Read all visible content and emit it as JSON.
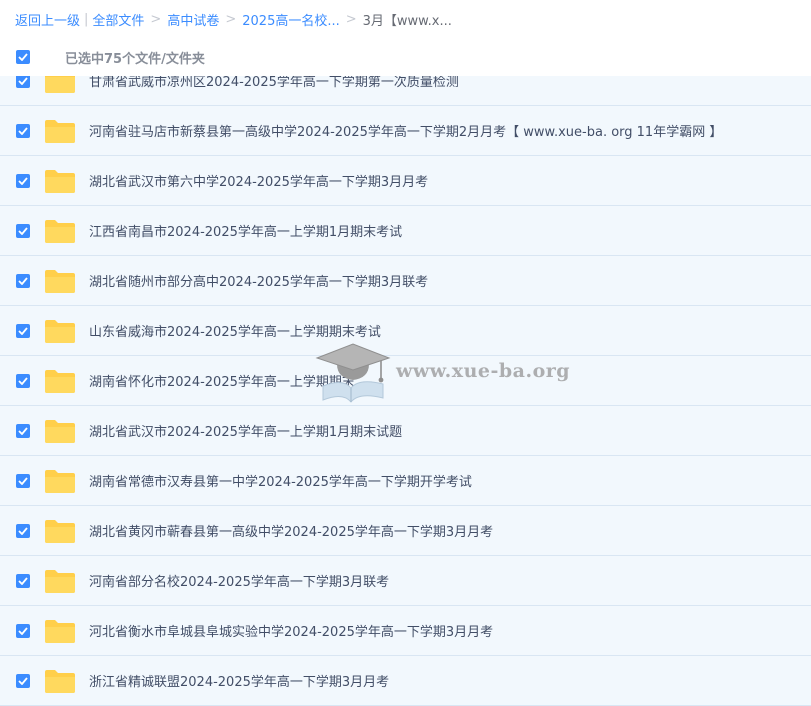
{
  "breadcrumb": {
    "back": "返回上一级",
    "all_files": "全部文件",
    "crumbs": [
      "高中试卷",
      "2025高一名校...",
      "3月【www.x..."
    ]
  },
  "selection": {
    "text": "已选中75个文件/文件夹",
    "checked": true
  },
  "files": [
    {
      "name": "甘肃省武威市凉州区2024-2025学年高一下学期第一次质量检测",
      "checked": true
    },
    {
      "name": "河南省驻马店市新蔡县第一高级中学2024-2025学年高一下学期2月月考【 www.xue-ba. org 11年学霸网 】",
      "checked": true
    },
    {
      "name": "湖北省武汉市第六中学2024-2025学年高一下学期3月月考",
      "checked": true
    },
    {
      "name": "江西省南昌市2024-2025学年高一上学期1月期末考试",
      "checked": true
    },
    {
      "name": "湖北省随州市部分高中2024-2025学年高一下学期3月联考",
      "checked": true
    },
    {
      "name": "山东省威海市2024-2025学年高一上学期期末考试",
      "checked": true
    },
    {
      "name": "湖南省怀化市2024-2025学年高一上学期期末",
      "checked": true
    },
    {
      "name": "湖北省武汉市2024-2025学年高一上学期1月期末试题",
      "checked": true
    },
    {
      "name": "湖南省常德市汉寿县第一中学2024-2025学年高一下学期开学考试",
      "checked": true
    },
    {
      "name": "湖北省黄冈市蕲春县第一高级中学2024-2025学年高一下学期3月月考",
      "checked": true
    },
    {
      "name": "河南省部分名校2024-2025学年高一下学期3月联考",
      "checked": true
    },
    {
      "name": "河北省衡水市阜城县阜城实验中学2024-2025学年高一下学期3月月考",
      "checked": true
    },
    {
      "name": "浙江省精诚联盟2024-2025学年高一下学期3月月考",
      "checked": true
    }
  ],
  "icons": {
    "checkbox": "checkbox-checked-icon",
    "folder": "folder-icon",
    "watermark": "graduation-cap-book-icon"
  },
  "colors": {
    "accent": "#3b8cff",
    "folder": "#ffcf4a",
    "row_bg": "#f2f8fd"
  },
  "watermark": {
    "text": "www.xue-ba.org"
  }
}
